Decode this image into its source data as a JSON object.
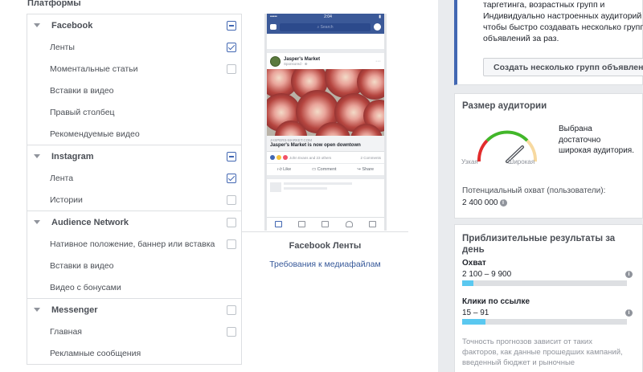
{
  "platforms": {
    "title": "Платформы",
    "groups": [
      {
        "label": "Facebook",
        "state": "partial",
        "items": [
          {
            "label": "Ленты",
            "checked": true
          },
          {
            "label": "Моментальные статьи",
            "checked": false
          },
          {
            "label": "Вставки в видео",
            "checked": null
          },
          {
            "label": "Правый столбец",
            "checked": null
          },
          {
            "label": "Рекомендуемые видео",
            "checked": null
          }
        ]
      },
      {
        "label": "Instagram",
        "state": "partial",
        "items": [
          {
            "label": "Лента",
            "checked": true
          },
          {
            "label": "Истории",
            "checked": false
          }
        ]
      },
      {
        "label": "Audience Network",
        "state": "unchecked",
        "items": [
          {
            "label": "Нативное положение, баннер или вставка",
            "checked": false
          },
          {
            "label": "Вставки в видео",
            "checked": null
          },
          {
            "label": "Видео с бонусами",
            "checked": null
          }
        ]
      },
      {
        "label": "Messenger",
        "state": "unchecked",
        "items": [
          {
            "label": "Главная",
            "checked": false
          },
          {
            "label": "Рекламные сообщения",
            "checked": null
          }
        ]
      }
    ]
  },
  "preview": {
    "status_time": "2:04",
    "search_placeholder": "Search",
    "advertiser": "Jasper's Market",
    "sponsored": "Sponsored · ⊕",
    "link_url": "JASPERS-MARKET.COM",
    "link_headline": "Jasper's Market is now open downtown",
    "reactions": "John Evans and 23 others",
    "comments_count": "2 Comments",
    "actions": [
      "Like",
      "Comment",
      "Share"
    ],
    "caption": "Facebook Ленты",
    "media_link": "Требования к медиафайлам"
  },
  "promo": {
    "lines": [
      "таргетинга, возрастных групп и",
      "Индивидуально настроенных аудиторий",
      "чтобы быстро создавать несколько групп",
      "объявлений за раз."
    ],
    "button": "Создать несколько групп объявлений"
  },
  "audience": {
    "title": "Размер аудитории",
    "narrow": "Узкая",
    "wide": "Широкая",
    "description": "Выбрана достаточно широкая аудитория.",
    "reach_label": "Потенциальный охват (пользователи):",
    "reach_value": "2 400 000"
  },
  "results": {
    "title": "Приблизительные результаты за день",
    "metrics": [
      {
        "label": "Охват",
        "value": "2 100 – 9 900",
        "fill": 0.07
      },
      {
        "label": "Клики по ссылке",
        "value": "15 – 91",
        "fill": 0.14
      }
    ],
    "note": "Точность прогнозов зависит от таких факторов, как данные прошедших кампаний, введенный бюджет и рыночные"
  },
  "colors": {
    "accent": "#4267b2",
    "link": "#365899",
    "bar_fill": "#5ac8f0"
  }
}
